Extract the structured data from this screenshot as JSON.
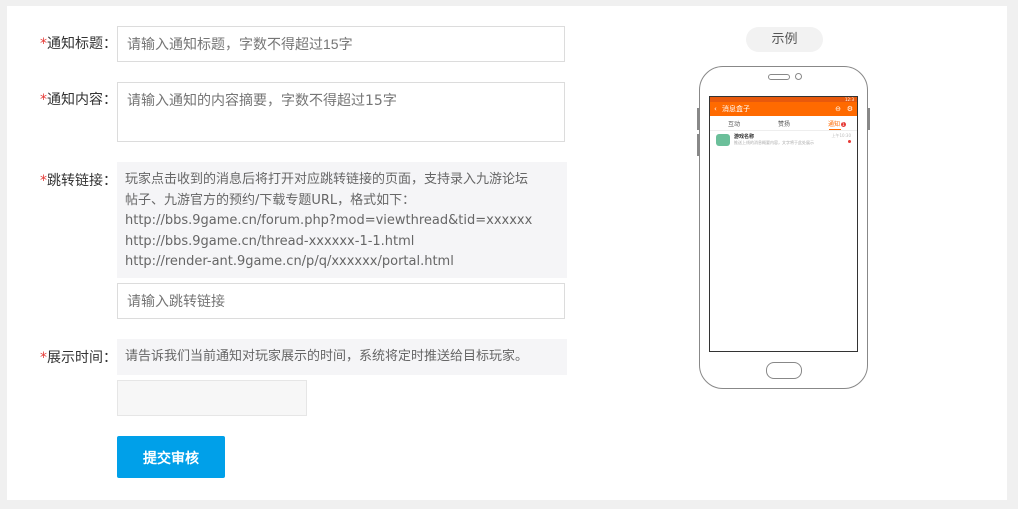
{
  "form": {
    "required_mark": "*",
    "title": {
      "label": "通知标题：",
      "placeholder": "请输入通知标题，字数不得超过15字"
    },
    "content": {
      "label": "通知内容：",
      "placeholder": "请输入通知的内容摘要，字数不得超过15字"
    },
    "link": {
      "label": "跳转链接：",
      "hint_lines": [
        "玩家点击收到的消息后将打开对应跳转链接的页面，支持录入九游论坛",
        "帖子、九游官方的预约/下载专题URL，格式如下：",
        "http://bbs.9game.cn/forum.php?mod=viewthread&tid=xxxxxx",
        "http://bbs.9game.cn/thread-xxxxxx-1-1.html",
        "http://render-ant.9game.cn/p/q/xxxxxx/portal.html"
      ],
      "placeholder": "请输入跳转链接"
    },
    "time": {
      "label": "展示时间：",
      "hint": "请告诉我们当前通知对玩家展示的时间，系统将定时推送给目标玩家。",
      "value": ""
    },
    "submit_label": "提交审核"
  },
  "preview": {
    "tag": "示例",
    "status_time": "12:3",
    "app_title": "消息盒子",
    "tabs": [
      "互动",
      "赞扬",
      "通知"
    ],
    "tab_badge": "1",
    "message_title": "游戏名称",
    "message_text": "推送上线的消息概要内容，文字将于此处展示",
    "message_time": "上午10:30",
    "accent_color": "#ff6a00"
  }
}
